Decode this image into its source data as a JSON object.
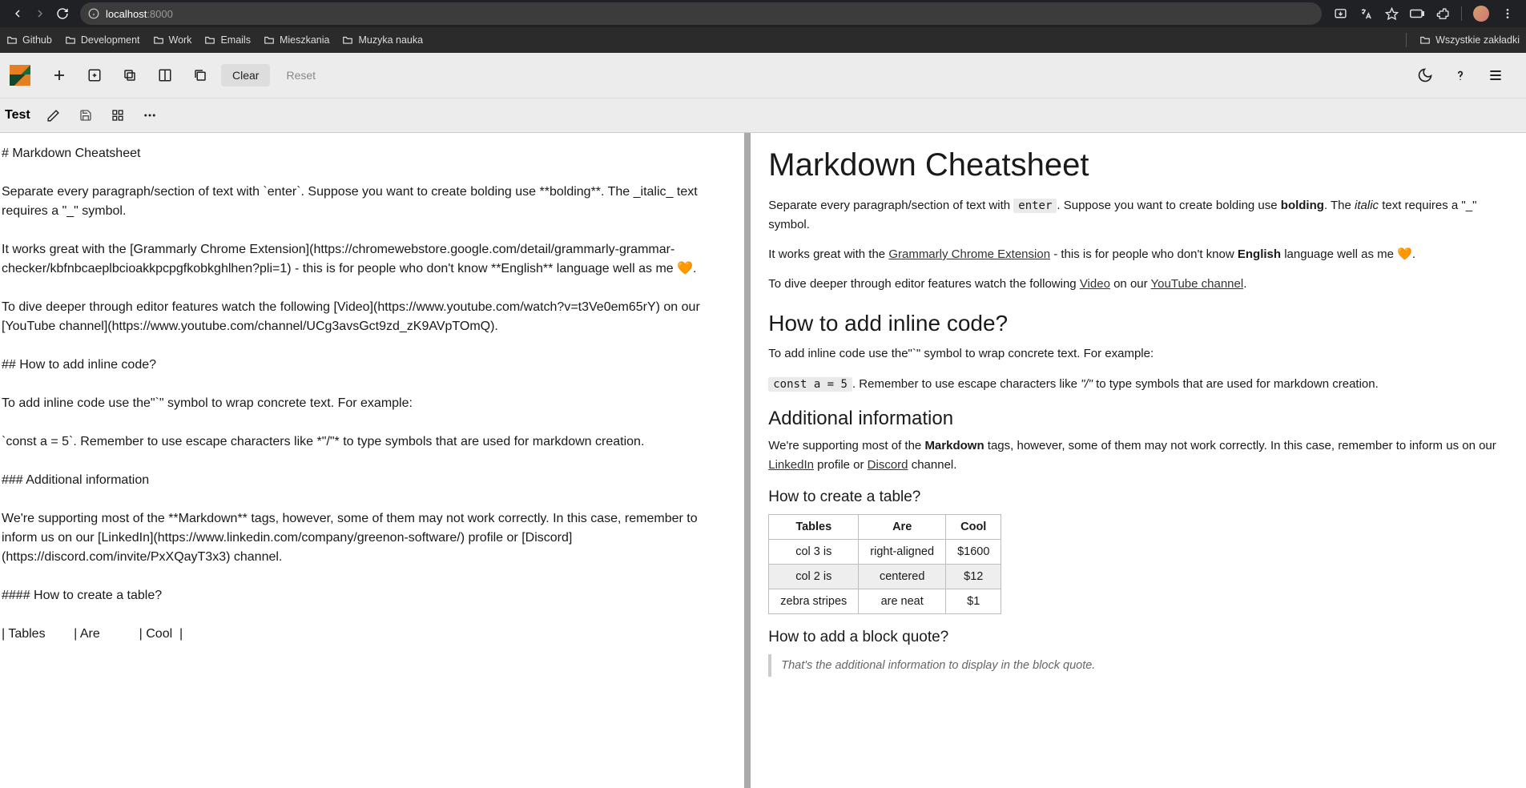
{
  "browser": {
    "url_host": "localhost",
    "url_port": ":8000",
    "bookmarks": [
      "Github",
      "Development",
      "Work",
      "Emails",
      "Mieszkania",
      "Muzyka nauka"
    ],
    "all_bookmarks": "Wszystkie zakładki"
  },
  "toolbar": {
    "clear": "Clear",
    "reset": "Reset"
  },
  "doc": {
    "title": "Test"
  },
  "source": "# Markdown Cheatsheet\n\nSeparate every paragraph/section of text with `enter`. Suppose you want to create bolding use **bolding**. The _italic_ text requires a \"_\" symbol.\n\nIt works great with the [Grammarly Chrome Extension](https://chromewebstore.google.com/detail/grammarly-grammar-checker/kbfnbcaeplbcioakkpcpgfkobkghlhen?pli=1) - this is for people who don't know **English** language well as me 🧡.\n\nTo dive deeper through editor features watch the following [Video](https://www.youtube.com/watch?v=t3Ve0em65rY) on our [YouTube channel](https://www.youtube.com/channel/UCg3avsGct9zd_zK9AVpTOmQ).\n\n## How to add inline code?\n\nTo add inline code use the\"`\" symbol to wrap concrete text. For example:\n\n`const a = 5`. Remember to use escape characters like *\"/\"* to type symbols that are used for markdown creation.\n\n### Additional information\n\nWe're supporting most of the **Markdown** tags, however, some of them may not work correctly. In this case, remember to inform us on our [LinkedIn](https://www.linkedin.com/company/greenon-software/) profile or [Discord](https://discord.com/invite/PxXQayT3x3) channel.\n\n#### How to create a table?\n\n| Tables        | Are           | Cool  |",
  "preview": {
    "h1": "Markdown Cheatsheet",
    "p1_a": "Separate every paragraph/section of text with ",
    "p1_code": "enter",
    "p1_b": ". Suppose you want to create bolding use ",
    "p1_bold": "bolding",
    "p1_c": ". The ",
    "p1_italic": "italic",
    "p1_d": " text requires a \"_\" symbol.",
    "p2_a": "It works great with the ",
    "p2_link1": "Grammarly Chrome Extension",
    "p2_b": " - this is for people who don't know ",
    "p2_bold": "English",
    "p2_c": " language well as me ",
    "p2_emoji": "🧡",
    "p2_d": ".",
    "p3_a": "To dive deeper through editor features watch the following ",
    "p3_link1": "Video",
    "p3_b": " on our ",
    "p3_link2": "YouTube channel",
    "p3_c": ".",
    "h2": "How to add inline code?",
    "p4": "To add inline code use the\"`\" symbol to wrap concrete text. For example:",
    "p5_code": "const a = 5",
    "p5_a": ". Remember to use escape characters like ",
    "p5_i": "\"/\"",
    "p5_b": " to type symbols that are used for markdown creation.",
    "h3": "Additional information",
    "p6_a": "We're supporting most of the ",
    "p6_bold": "Markdown",
    "p6_b": " tags, however, some of them may not work correctly. In this case, remember to inform us on our ",
    "p6_link1": "LinkedIn",
    "p6_c": " profile or ",
    "p6_link2": "Discord",
    "p6_d": " channel.",
    "h4_table": "How to create a table?",
    "table": {
      "headers": [
        "Tables",
        "Are",
        "Cool"
      ],
      "rows": [
        [
          "col 3 is",
          "right-aligned",
          "$1600"
        ],
        [
          "col 2 is",
          "centered",
          "$12"
        ],
        [
          "zebra stripes",
          "are neat",
          "$1"
        ]
      ]
    },
    "h4_quote": "How to add a block quote?",
    "blockquote": "That's the additional information to display in the block quote."
  }
}
